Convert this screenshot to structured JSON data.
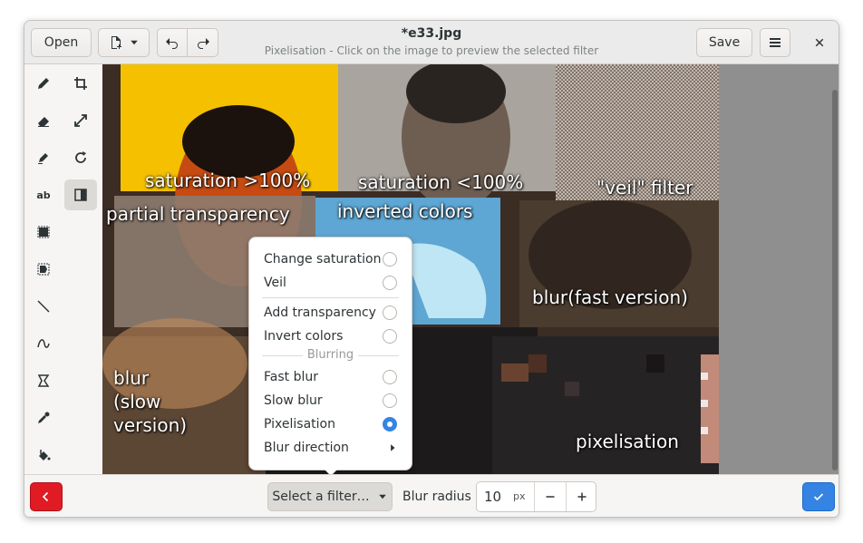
{
  "header": {
    "open_label": "Open",
    "title": "*e33.jpg",
    "subtitle": "Pixelisation - Click on the image to preview the selected filter",
    "save_label": "Save"
  },
  "image_labels": {
    "sat_high": "saturation >100%",
    "sat_low": "saturation <100%",
    "veil": "\"veil\" filter",
    "partial": "partial transparency",
    "inverted": "inverted colors",
    "blur_fast": "blur(fast version)",
    "blur_slow": "blur\n(slow\nversion)",
    "pixelisation": "pixelisation"
  },
  "filters_menu": {
    "items": [
      {
        "label": "Change saturation",
        "checked": false
      },
      {
        "label": "Veil",
        "checked": false
      },
      {
        "label": "Add transparency",
        "checked": false
      },
      {
        "label": "Invert colors",
        "checked": false
      },
      {
        "label": "Fast blur",
        "checked": false
      },
      {
        "label": "Slow blur",
        "checked": false
      },
      {
        "label": "Pixelisation",
        "checked": true
      }
    ],
    "section_label": "Blurring",
    "submenu_label": "Blur direction"
  },
  "bottom": {
    "select_label": "Select a filter…",
    "radius_label": "Blur radius",
    "radius_value": "10",
    "radius_unit": "px"
  },
  "colors": {
    "accent": "#3584e4",
    "cancel": "#e01b24"
  }
}
